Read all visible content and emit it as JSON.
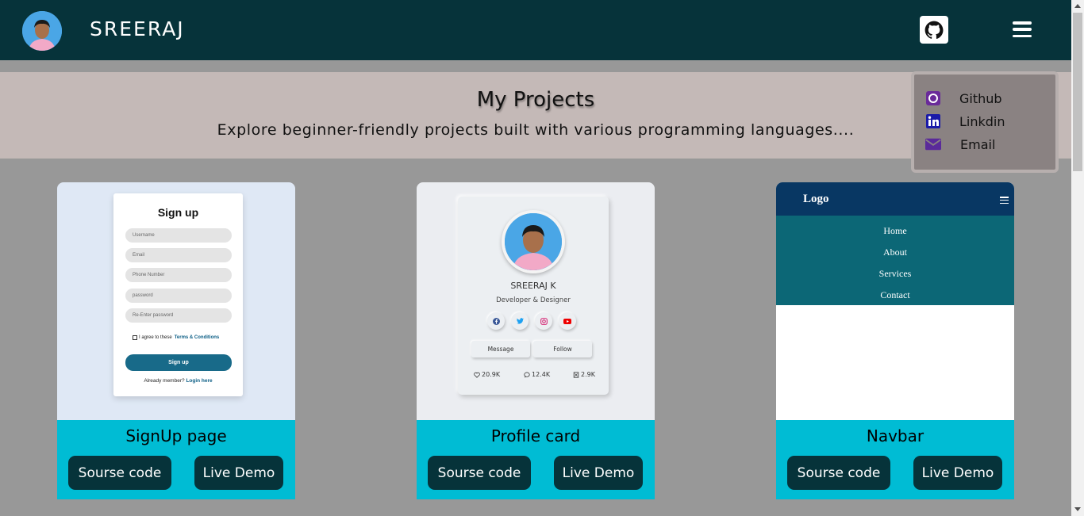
{
  "header": {
    "brand": "SREERAJ",
    "github_icon": "github-icon",
    "menu_icon": "hamburger-icon"
  },
  "hero": {
    "title": "My Projects",
    "subtitle": "Explore beginner-friendly projects built with various programming languages...."
  },
  "dropdown": {
    "items": [
      {
        "label": "Github",
        "icon": "github-icon",
        "color": "#6a2a9a"
      },
      {
        "label": "Linkdin",
        "icon": "linkedin-icon",
        "color": "#1a1aa8"
      },
      {
        "label": "Email",
        "icon": "email-icon",
        "color": "#5a2a9a"
      }
    ]
  },
  "cards": [
    {
      "title": "SignUp page",
      "source_label": "Sourse code",
      "demo_label": "Live Demo",
      "preview": {
        "heading": "Sign up",
        "fields": [
          "Username",
          "Email",
          "Phone Number",
          "password",
          "Re-Enter password"
        ],
        "agree_text": "I agree to these",
        "agree_link": "Terms & Conditions",
        "submit": "Sign up",
        "login_text": "Already member?",
        "login_link": "Login here"
      }
    },
    {
      "title": "Profile card",
      "source_label": "Sourse code",
      "demo_label": "Live Demo",
      "preview": {
        "name": "SREERAJ K",
        "role": "Developer & Designer",
        "message": "Message",
        "follow": "Follow",
        "stats": [
          "20.9K",
          "12.4K",
          "2.9K"
        ]
      }
    },
    {
      "title": "Navbar",
      "source_label": "Sourse code",
      "demo_label": "Live Demo",
      "preview": {
        "logo": "Logo",
        "menu": [
          "Home",
          "About",
          "Services",
          "Contact"
        ]
      }
    }
  ],
  "colors": {
    "header_bg": "#06333a",
    "accent": "#00bcd4",
    "page_bg": "#989898"
  }
}
